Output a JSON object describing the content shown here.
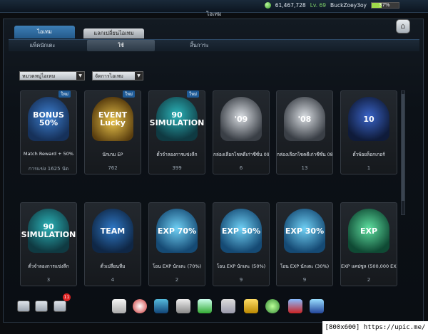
{
  "topbar": {
    "coins": "61,467,728",
    "level": "Lv. 69",
    "username": "BuckZoey3oy",
    "hp_percent": "37%",
    "hp_fraction": 0.37
  },
  "window": {
    "title": "ไอเทม"
  },
  "tabs": [
    {
      "label": "ไอเทม"
    },
    {
      "label": "แลกเปลี่ยนไอเทม"
    }
  ],
  "subtabs": [
    {
      "label": "แพ็คนักเตะ"
    },
    {
      "label": "ใช้"
    },
    {
      "label": "สิ้นการะ"
    }
  ],
  "filters": [
    {
      "label": "หมวดหมู่ไอเทม"
    },
    {
      "label": "จัดการไอเทม"
    }
  ],
  "new_label": "ใหม่",
  "cards_row1": [
    {
      "name": "Match Reward + 50%",
      "count": "การแข่ง 1625 นัด",
      "icon": "bonus-50-icon",
      "art_text": "BONUS 50%",
      "new": true
    },
    {
      "name": "นักเกม EP",
      "count": "762",
      "icon": "lucky-event-icon",
      "art_text": "EVENT Lucky",
      "new": true
    },
    {
      "name": "ตั๋วจำลองการแข่งลีก",
      "count": "399",
      "icon": "simulation-90-icon",
      "art_text": "90 SIMULATION",
      "new": true
    },
    {
      "name": "กล่องเลือกโชคดีเก่าซีซั่น 09",
      "count": "6",
      "icon": "mystery-box-09-icon",
      "art_text": "'09",
      "new": false
    },
    {
      "name": "กล่องเลือกโชคดีเก่าซีซั่น 08",
      "count": "13",
      "icon": "mystery-box-08-icon",
      "art_text": "'08",
      "new": false
    },
    {
      "name": "ตั๋วพ้อยล็อกเกอร์",
      "count": "1",
      "icon": "jersey-10-icon",
      "art_text": "10",
      "new": false
    }
  ],
  "cards_row2": [
    {
      "name": "ตั๋วจำลองการแข่งลีก",
      "count": "3",
      "icon": "simulation-90-icon",
      "art_text": "90 SIMULATION"
    },
    {
      "name": "ตั๋วเปลี่ยนทีม",
      "count": "4",
      "icon": "team-arrows-icon",
      "art_text": "TEAM"
    },
    {
      "name": "โอน EXP นักเตะ (70%)",
      "count": "2",
      "icon": "exp-70-icon",
      "art_text": "EXP 70%"
    },
    {
      "name": "โอน EXP นักเตะ (50%)",
      "count": "9",
      "icon": "exp-50-icon",
      "art_text": "EXP 50%"
    },
    {
      "name": "โอน EXP นักเตะ (30%)",
      "count": "9",
      "icon": "exp-30-icon",
      "art_text": "EXP 30%"
    },
    {
      "name": "EXP แคปซูล (500,000 EXP)",
      "count": "2",
      "icon": "exp-capsule-icon",
      "art_text": "EXP"
    }
  ],
  "bottom": {
    "badge_count": "11"
  },
  "watermark": "[800x600] https://upic.me/",
  "colors": {
    "accent": "#2d6ea6",
    "exp": "#3fa9e8",
    "gold": "#e0b640",
    "green": "#2fae6a"
  }
}
